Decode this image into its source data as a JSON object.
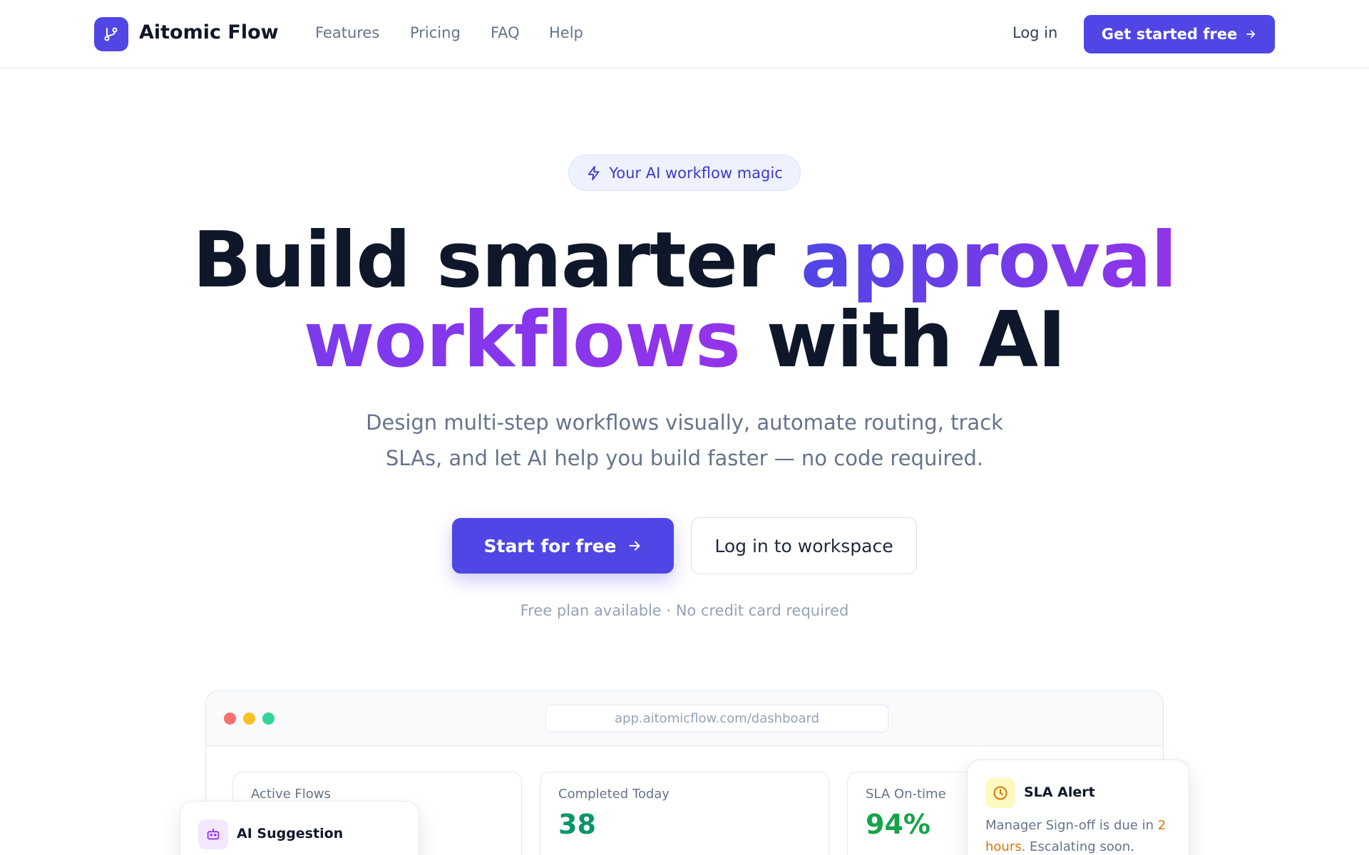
{
  "nav": {
    "brand": "Aitomic Flow",
    "links": [
      "Features",
      "Pricing",
      "FAQ",
      "Help"
    ],
    "login": "Log in",
    "cta": "Get started free"
  },
  "hero": {
    "badge": "Your AI workflow magic",
    "headline": {
      "part1": "Build smarter ",
      "accent1": "approval",
      "accent2": "workflows",
      "part2": " with AI"
    },
    "subtitle_line1": "Design multi-step workflows visually, automate routing, track",
    "subtitle_line2": "SLAs, and let AI help you build faster — no code required.",
    "primary_button": "Start for free",
    "secondary_button": "Log in to workspace",
    "note": "Free plan available · No credit card required"
  },
  "preview": {
    "url": "app.aitomicflow.com/dashboard",
    "stats": [
      {
        "label": "Active Flows",
        "value": ""
      },
      {
        "label": "Completed Today",
        "value": "38"
      },
      {
        "label": "SLA On-time",
        "value": "94%"
      }
    ],
    "ai_card": {
      "title": "AI Suggestion"
    },
    "sla_card": {
      "title": "SLA Alert",
      "text_before": "Manager Sign-off is due in ",
      "highlight_a": "2",
      "highlight_b": "hours",
      "text_after": ". Escalating soon."
    }
  },
  "colors": {
    "accent": "#4f46e5",
    "purple": "#9333ea",
    "success": "#16a34a",
    "warning": "#d97706"
  },
  "icons": {
    "logo": "branch-icon",
    "badge": "lightning-icon",
    "arrow": "arrow-right-icon",
    "ai": "robot-icon",
    "sla": "clock-icon"
  }
}
